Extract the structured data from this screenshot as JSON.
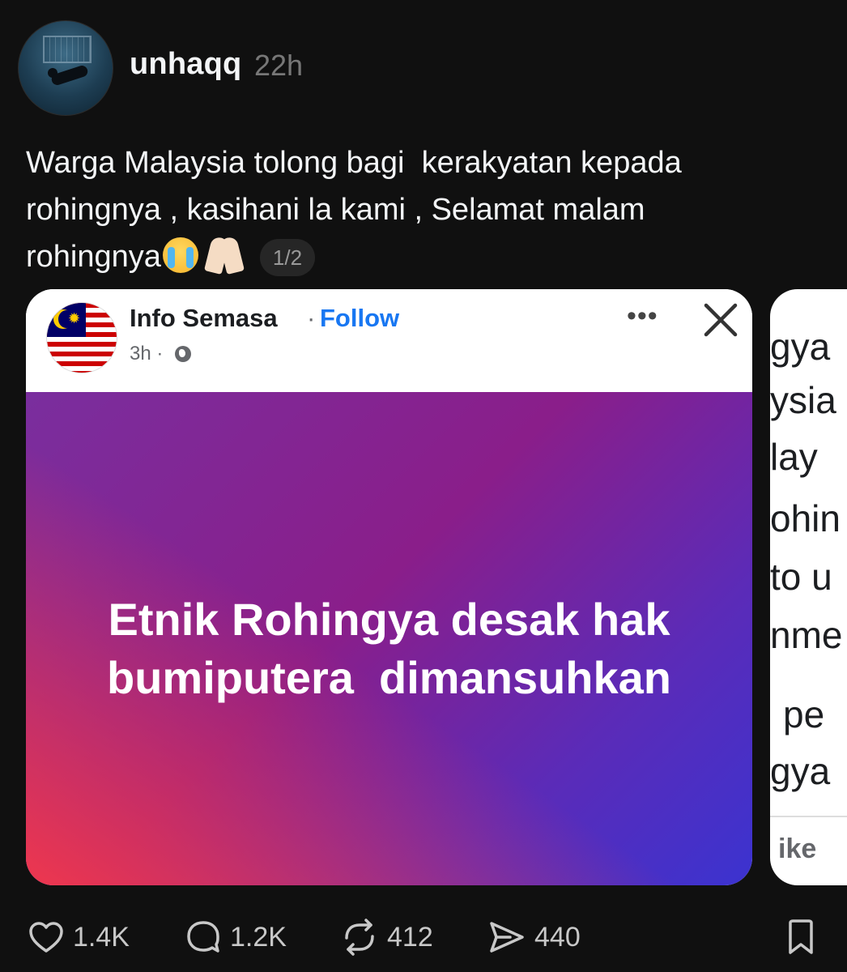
{
  "post": {
    "username": "unhaqq",
    "timestamp": "22h",
    "text_lines": [
      "Warga Malaysia tolong bagi  kerakyatan kepada",
      "rohingnya , kasihani la kami , Selamat malam",
      "rohingnya"
    ],
    "emojis": [
      "loudly-crying-face",
      "folded-hands"
    ],
    "page_indicator": "1/2"
  },
  "embedded": {
    "page_name": "Info Semasa",
    "separator": "·",
    "follow_label": "Follow",
    "time": "3h ·",
    "headline_lines": [
      "Etnik Rohingya desak hak",
      "bumiputera  dimansuhkan"
    ]
  },
  "next_card": {
    "fragments": [
      "gya",
      "ysia",
      "lay",
      "ohin",
      "to u",
      "nme",
      "pe",
      "gya"
    ],
    "like_fragment": "ike"
  },
  "actions": {
    "likes": "1.4K",
    "replies": "1.2K",
    "reposts": "412",
    "shares": "440"
  },
  "colors": {
    "background": "#101010",
    "follow": "#1877f2",
    "muted": "#777777"
  }
}
